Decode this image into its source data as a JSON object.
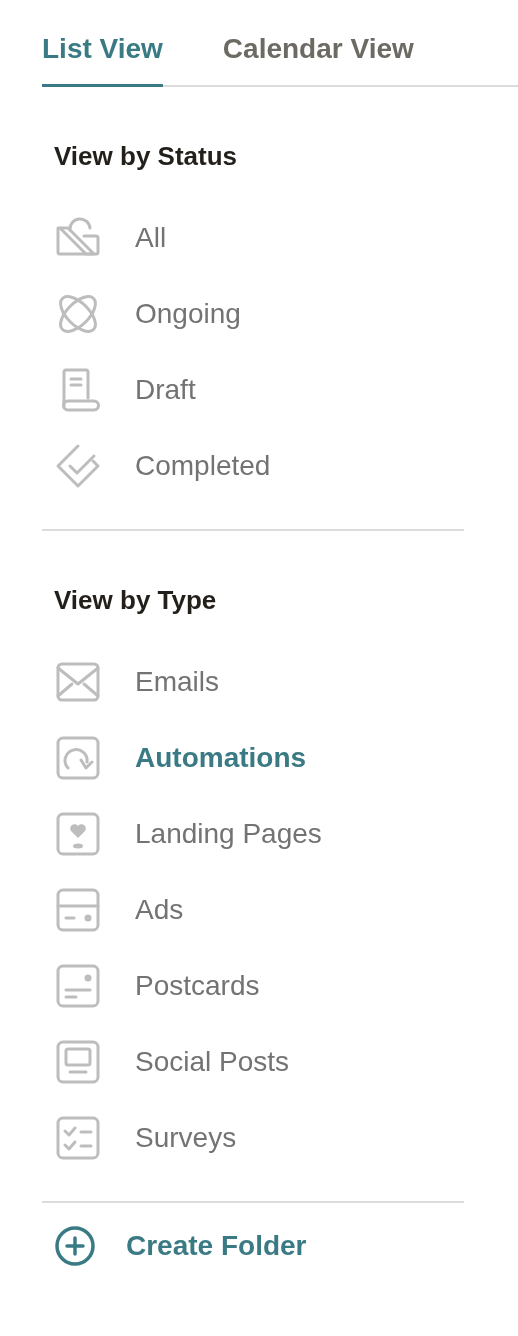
{
  "tabs": [
    {
      "label": "List View",
      "selected": true
    },
    {
      "label": "Calendar View",
      "selected": false
    }
  ],
  "sections": [
    {
      "title": "View by Status",
      "items": [
        {
          "label": "All",
          "selected": false
        },
        {
          "label": "Ongoing",
          "selected": false
        },
        {
          "label": "Draft",
          "selected": false
        },
        {
          "label": "Completed",
          "selected": false
        }
      ]
    },
    {
      "title": "View by Type",
      "items": [
        {
          "label": "Emails",
          "selected": false
        },
        {
          "label": "Automations",
          "selected": true
        },
        {
          "label": "Landing Pages",
          "selected": false
        },
        {
          "label": "Ads",
          "selected": false
        },
        {
          "label": "Postcards",
          "selected": false
        },
        {
          "label": "Social Posts",
          "selected": false
        },
        {
          "label": "Surveys",
          "selected": false
        }
      ]
    }
  ],
  "create_folder": {
    "label": "Create Folder"
  }
}
